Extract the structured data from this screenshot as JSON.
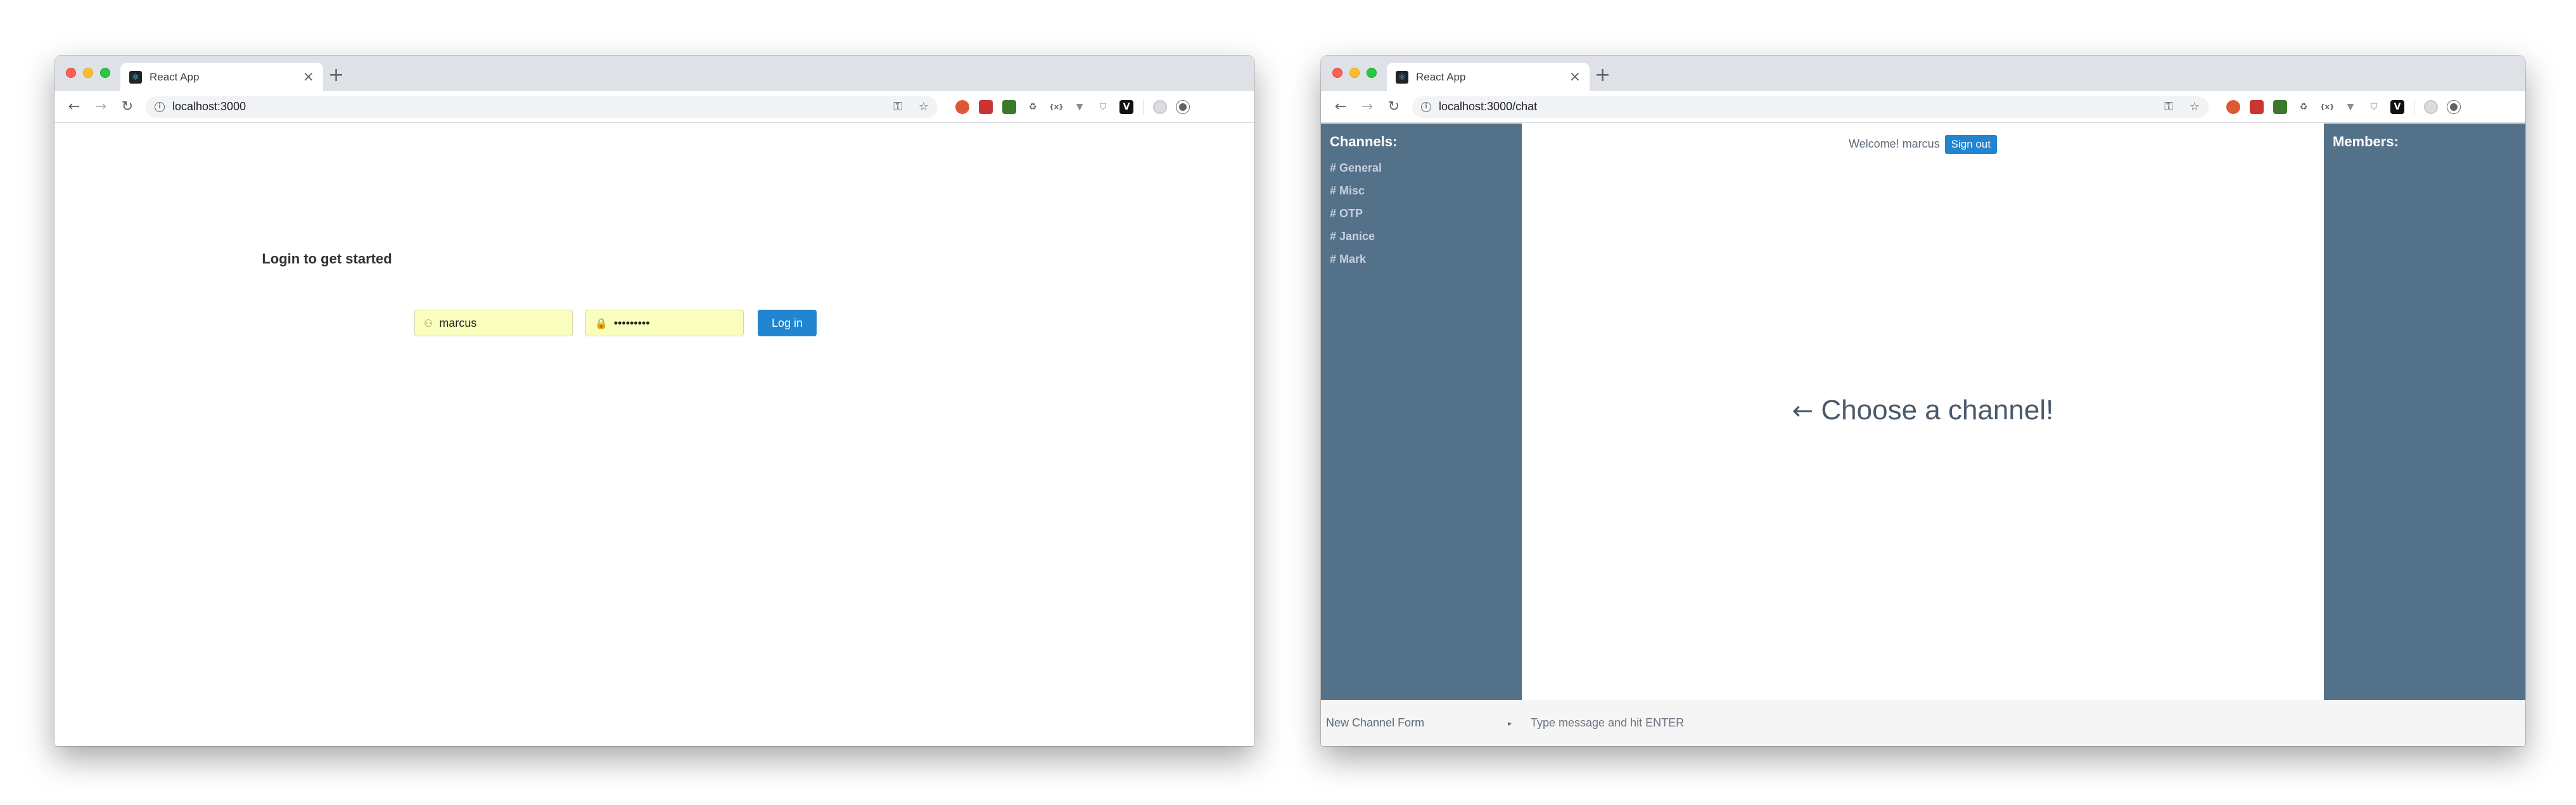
{
  "colors": {
    "sidebar": "#54718a",
    "primary_button": "#2185d0",
    "autofill": "#faffbd"
  },
  "login_window": {
    "tab_title": "React App",
    "url": "localhost:3000",
    "page": {
      "heading": "Login to get started",
      "username_value": "marcus",
      "password_value": "•••••••••",
      "login_button": "Log in"
    }
  },
  "chat_window": {
    "tab_title": "React App",
    "url": "localhost:3000/chat",
    "sidebar": {
      "heading": "Channels:",
      "channels": [
        "# General",
        "# Misc",
        "# OTP",
        "# Janice",
        "# Mark"
      ]
    },
    "main": {
      "welcome": "Welcome! marcus",
      "signout_button": "Sign out",
      "choose_arrow": "←",
      "choose_text": "Choose a channel!"
    },
    "members": {
      "heading": "Members:"
    },
    "footer": {
      "new_channel_label": "New Channel Form",
      "new_channel_toggle": "▸",
      "message_placeholder": "Type message and hit ENTER"
    }
  }
}
